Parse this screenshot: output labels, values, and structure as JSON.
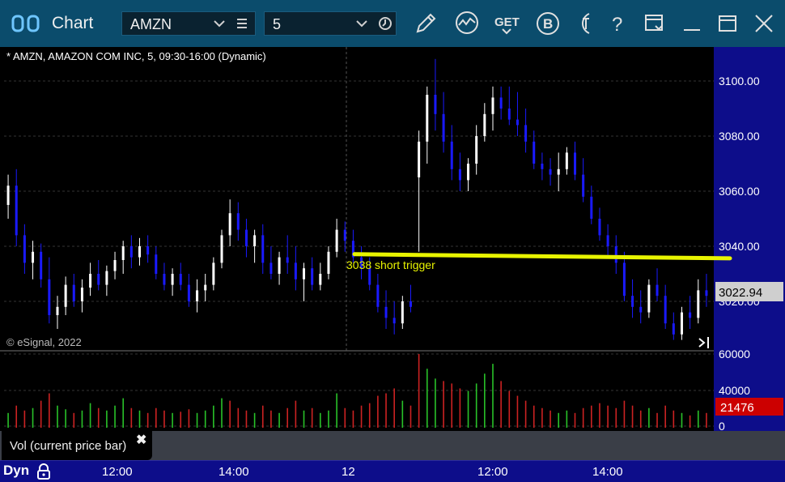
{
  "app": {
    "title": "Chart"
  },
  "toolbar": {
    "symbol": "AMZN",
    "interval": "5",
    "icons": [
      "app-logo-icon",
      "chevron-down-icon",
      "list-icon",
      "clock-icon",
      "pencil-icon",
      "study-icon",
      "get-icon",
      "b-icon",
      "t-icon",
      "help-icon",
      "window-icon",
      "minimize-icon",
      "maximize-icon",
      "close-icon"
    ],
    "get_label": "GET",
    "b_label": "B",
    "help_label": "?"
  },
  "chart": {
    "header": "* AMZN, AMAZON COM INC, 5, 09:30-16:00 (Dynamic)",
    "copyright": "© eSignal, 2022",
    "current_price_label": "3022.94",
    "annotation": "3038 short trigger",
    "annotation_color": "#e8f400"
  },
  "volume": {
    "current_label": "21476",
    "current_color": "#cc0000"
  },
  "study": {
    "label": "Vol (current price bar)",
    "close": "✖"
  },
  "timebar": {
    "mode": "Dyn",
    "labels": [
      "12:00",
      "14:00",
      "12",
      "12:00",
      "14:00"
    ]
  },
  "colors": {
    "up": "#ffffff",
    "down": "#1a1aff",
    "vol_up": "#29c229",
    "vol_down": "#cc2222",
    "axis_bg": "#0d0d8a",
    "titlebar": "#0b4c6c"
  },
  "chart_data": {
    "type": "candlestick",
    "ylim": [
      3005,
      3110
    ],
    "yticks": [
      "3100.00",
      "3080.00",
      "3060.00",
      "3040.00",
      "3020.00"
    ],
    "vol_ylim": [
      0,
      60000
    ],
    "vol_yticks": [
      "60000",
      "40000",
      "0"
    ],
    "x_labels": [
      "12:00",
      "14:00",
      "12",
      "12:00",
      "14:00"
    ],
    "trigger_line": {
      "price_start": 3038,
      "price_end": 3036.5
    },
    "candles": [
      [
        3055,
        3066,
        3050,
        3062
      ],
      [
        3062,
        3068,
        3040,
        3044
      ],
      [
        3044,
        3048,
        3030,
        3034
      ],
      [
        3034,
        3042,
        3028,
        3038
      ],
      [
        3038,
        3041,
        3025,
        3028
      ],
      [
        3028,
        3036,
        3012,
        3015
      ],
      [
        3015,
        3022,
        3010,
        3018
      ],
      [
        3018,
        3029,
        3015,
        3026
      ],
      [
        3026,
        3030,
        3018,
        3020
      ],
      [
        3020,
        3028,
        3016,
        3025
      ],
      [
        3025,
        3034,
        3022,
        3030
      ],
      [
        3030,
        3035,
        3024,
        3026
      ],
      [
        3026,
        3033,
        3022,
        3031
      ],
      [
        3031,
        3038,
        3028,
        3035
      ],
      [
        3035,
        3042,
        3030,
        3040
      ],
      [
        3040,
        3044,
        3032,
        3036
      ],
      [
        3036,
        3043,
        3033,
        3040
      ],
      [
        3040,
        3044,
        3034,
        3037
      ],
      [
        3037,
        3040,
        3028,
        3030
      ],
      [
        3030,
        3034,
        3024,
        3026
      ],
      [
        3026,
        3032,
        3022,
        3030
      ],
      [
        3030,
        3034,
        3024,
        3026
      ],
      [
        3026,
        3030,
        3018,
        3020
      ],
      [
        3020,
        3028,
        3016,
        3024
      ],
      [
        3024,
        3030,
        3020,
        3026
      ],
      [
        3026,
        3036,
        3024,
        3034
      ],
      [
        3034,
        3046,
        3032,
        3044
      ],
      [
        3044,
        3057,
        3040,
        3052
      ],
      [
        3052,
        3056,
        3042,
        3046
      ],
      [
        3046,
        3050,
        3036,
        3040
      ],
      [
        3040,
        3046,
        3034,
        3044
      ],
      [
        3044,
        3048,
        3030,
        3034
      ],
      [
        3034,
        3040,
        3028,
        3030
      ],
      [
        3030,
        3038,
        3026,
        3036
      ],
      [
        3036,
        3044,
        3030,
        3034
      ],
      [
        3034,
        3040,
        3024,
        3028
      ],
      [
        3028,
        3034,
        3020,
        3032
      ],
      [
        3032,
        3036,
        3024,
        3026
      ],
      [
        3026,
        3034,
        3024,
        3030
      ],
      [
        3030,
        3040,
        3028,
        3038
      ],
      [
        3038,
        3050,
        3036,
        3046
      ],
      [
        3046,
        3049,
        3038,
        3042
      ],
      [
        3042,
        3046,
        3034,
        3036
      ],
      [
        3036,
        3040,
        3028,
        3032
      ],
      [
        3032,
        3036,
        3024,
        3026
      ],
      [
        3026,
        3030,
        3016,
        3018
      ],
      [
        3018,
        3024,
        3010,
        3014
      ],
      [
        3014,
        3020,
        3008,
        3012
      ],
      [
        3012,
        3022,
        3010,
        3020
      ],
      [
        3020,
        3026,
        3016,
        3018
      ],
      [
        3065,
        3082,
        3038,
        3078
      ],
      [
        3078,
        3098,
        3070,
        3095
      ],
      [
        3095,
        3108,
        3082,
        3088
      ],
      [
        3088,
        3096,
        3074,
        3078
      ],
      [
        3078,
        3084,
        3064,
        3068
      ],
      [
        3068,
        3074,
        3060,
        3064
      ],
      [
        3064,
        3072,
        3060,
        3070
      ],
      [
        3070,
        3084,
        3066,
        3080
      ],
      [
        3080,
        3092,
        3078,
        3088
      ],
      [
        3088,
        3098,
        3082,
        3094
      ],
      [
        3094,
        3098,
        3086,
        3090
      ],
      [
        3090,
        3098,
        3084,
        3086
      ],
      [
        3086,
        3096,
        3080,
        3084
      ],
      [
        3084,
        3090,
        3074,
        3078
      ],
      [
        3078,
        3082,
        3068,
        3070
      ],
      [
        3070,
        3074,
        3064,
        3068
      ],
      [
        3068,
        3072,
        3062,
        3066
      ],
      [
        3066,
        3074,
        3060,
        3068
      ],
      [
        3068,
        3076,
        3066,
        3074
      ],
      [
        3074,
        3078,
        3064,
        3066
      ],
      [
        3066,
        3072,
        3056,
        3058
      ],
      [
        3058,
        3062,
        3048,
        3050
      ],
      [
        3050,
        3054,
        3042,
        3044
      ],
      [
        3044,
        3048,
        3036,
        3040
      ],
      [
        3040,
        3044,
        3030,
        3034
      ],
      [
        3034,
        3038,
        3020,
        3022
      ],
      [
        3022,
        3028,
        3014,
        3018
      ],
      [
        3018,
        3024,
        3012,
        3016
      ],
      [
        3016,
        3028,
        3014,
        3026
      ],
      [
        3026,
        3032,
        3020,
        3022
      ],
      [
        3022,
        3026,
        3010,
        3012
      ],
      [
        3012,
        3016,
        3006,
        3008
      ],
      [
        3008,
        3018,
        3006,
        3016
      ],
      [
        3016,
        3022,
        3010,
        3014
      ],
      [
        3014,
        3028,
        3012,
        3024
      ],
      [
        3024,
        3030,
        3018,
        3022
      ]
    ],
    "volumes": [
      [
        12000,
        0
      ],
      [
        18000,
        1
      ],
      [
        14000,
        1
      ],
      [
        16000,
        0
      ],
      [
        22000,
        1
      ],
      [
        28000,
        1
      ],
      [
        18000,
        0
      ],
      [
        15000,
        0
      ],
      [
        12000,
        1
      ],
      [
        14000,
        0
      ],
      [
        20000,
        0
      ],
      [
        16000,
        1
      ],
      [
        14000,
        0
      ],
      [
        18000,
        0
      ],
      [
        24000,
        0
      ],
      [
        16000,
        1
      ],
      [
        14000,
        0
      ],
      [
        12000,
        1
      ],
      [
        16000,
        1
      ],
      [
        14000,
        1
      ],
      [
        12000,
        0
      ],
      [
        13000,
        1
      ],
      [
        15000,
        1
      ],
      [
        12000,
        0
      ],
      [
        14000,
        0
      ],
      [
        18000,
        0
      ],
      [
        24000,
        0
      ],
      [
        22000,
        1
      ],
      [
        16000,
        1
      ],
      [
        14000,
        1
      ],
      [
        12000,
        0
      ],
      [
        18000,
        1
      ],
      [
        14000,
        1
      ],
      [
        12000,
        0
      ],
      [
        16000,
        1
      ],
      [
        22000,
        1
      ],
      [
        14000,
        0
      ],
      [
        16000,
        1
      ],
      [
        12000,
        0
      ],
      [
        14000,
        0
      ],
      [
        28000,
        0
      ],
      [
        16000,
        1
      ],
      [
        14000,
        1
      ],
      [
        18000,
        1
      ],
      [
        20000,
        1
      ],
      [
        26000,
        1
      ],
      [
        28000,
        1
      ],
      [
        32000,
        1
      ],
      [
        22000,
        0
      ],
      [
        18000,
        1
      ],
      [
        60000,
        1
      ],
      [
        48000,
        0
      ],
      [
        40000,
        0
      ],
      [
        38000,
        1
      ],
      [
        36000,
        1
      ],
      [
        32000,
        1
      ],
      [
        30000,
        0
      ],
      [
        36000,
        0
      ],
      [
        44000,
        0
      ],
      [
        52000,
        0
      ],
      [
        38000,
        1
      ],
      [
        30000,
        1
      ],
      [
        26000,
        1
      ],
      [
        22000,
        1
      ],
      [
        18000,
        1
      ],
      [
        16000,
        1
      ],
      [
        14000,
        1
      ],
      [
        12000,
        0
      ],
      [
        14000,
        0
      ],
      [
        12000,
        1
      ],
      [
        16000,
        1
      ],
      [
        18000,
        1
      ],
      [
        20000,
        1
      ],
      [
        18000,
        1
      ],
      [
        16000,
        1
      ],
      [
        22000,
        1
      ],
      [
        18000,
        1
      ],
      [
        14000,
        1
      ],
      [
        16000,
        0
      ],
      [
        12000,
        1
      ],
      [
        18000,
        1
      ],
      [
        14000,
        1
      ],
      [
        12000,
        0
      ],
      [
        10000,
        1
      ],
      [
        14000,
        0
      ],
      [
        12000,
        1
      ]
    ]
  }
}
